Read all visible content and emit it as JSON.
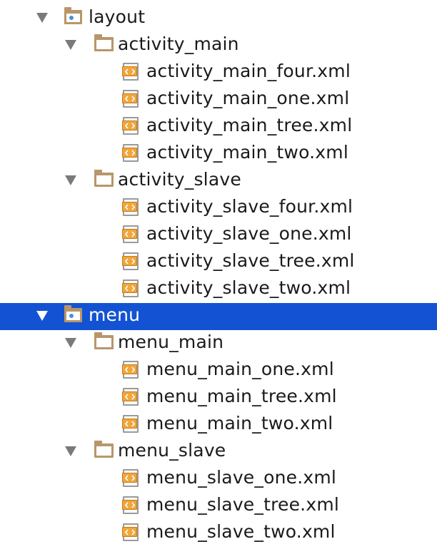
{
  "tree": [
    {
      "id": "layout",
      "label": "layout",
      "level": 0,
      "kind": "res-folder",
      "expanded": true,
      "selected": false
    },
    {
      "id": "activity-main",
      "label": "activity_main",
      "level": 1,
      "kind": "folder",
      "expanded": true,
      "selected": false
    },
    {
      "id": "activity-main-four",
      "label": "activity_main_four.xml",
      "level": 2,
      "kind": "xml",
      "selected": false
    },
    {
      "id": "activity-main-one",
      "label": "activity_main_one.xml",
      "level": 2,
      "kind": "xml",
      "selected": false
    },
    {
      "id": "activity-main-tree",
      "label": "activity_main_tree.xml",
      "level": 2,
      "kind": "xml",
      "selected": false
    },
    {
      "id": "activity-main-two",
      "label": "activity_main_two.xml",
      "level": 2,
      "kind": "xml",
      "selected": false
    },
    {
      "id": "activity-slave",
      "label": "activity_slave",
      "level": 1,
      "kind": "folder",
      "expanded": true,
      "selected": false
    },
    {
      "id": "activity-slave-four",
      "label": "activity_slave_four.xml",
      "level": 2,
      "kind": "xml",
      "selected": false
    },
    {
      "id": "activity-slave-one",
      "label": "activity_slave_one.xml",
      "level": 2,
      "kind": "xml",
      "selected": false
    },
    {
      "id": "activity-slave-tree",
      "label": "activity_slave_tree.xml",
      "level": 2,
      "kind": "xml",
      "selected": false
    },
    {
      "id": "activity-slave-two",
      "label": "activity_slave_two.xml",
      "level": 2,
      "kind": "xml",
      "selected": false
    },
    {
      "id": "menu",
      "label": "menu",
      "level": 0,
      "kind": "res-folder",
      "expanded": true,
      "selected": true
    },
    {
      "id": "menu-main",
      "label": "menu_main",
      "level": 1,
      "kind": "folder",
      "expanded": true,
      "selected": false
    },
    {
      "id": "menu-main-one",
      "label": "menu_main_one.xml",
      "level": 2,
      "kind": "xml",
      "selected": false
    },
    {
      "id": "menu-main-tree",
      "label": "menu_main_tree.xml",
      "level": 2,
      "kind": "xml",
      "selected": false
    },
    {
      "id": "menu-main-two",
      "label": "menu_main_two.xml",
      "level": 2,
      "kind": "xml",
      "selected": false
    },
    {
      "id": "menu-slave",
      "label": "menu_slave",
      "level": 1,
      "kind": "folder",
      "expanded": true,
      "selected": false
    },
    {
      "id": "menu-slave-one",
      "label": "menu_slave_one.xml",
      "level": 2,
      "kind": "xml",
      "selected": false
    },
    {
      "id": "menu-slave-tree",
      "label": "menu_slave_tree.xml",
      "level": 2,
      "kind": "xml",
      "selected": false
    },
    {
      "id": "menu-slave-two",
      "label": "menu_slave_two.xml",
      "level": 2,
      "kind": "xml",
      "selected": false
    }
  ],
  "colors": {
    "selection": "#1353d3",
    "folder": "#b8966a",
    "xml_band": "#f0a63c",
    "resource_dot": "#4a8fd6",
    "arrow": "#7a7a7a"
  },
  "icons": {
    "expand_arrow": "triangle-down-icon",
    "res-folder": "resource-folder-icon",
    "folder": "folder-icon",
    "xml": "xml-file-icon"
  }
}
